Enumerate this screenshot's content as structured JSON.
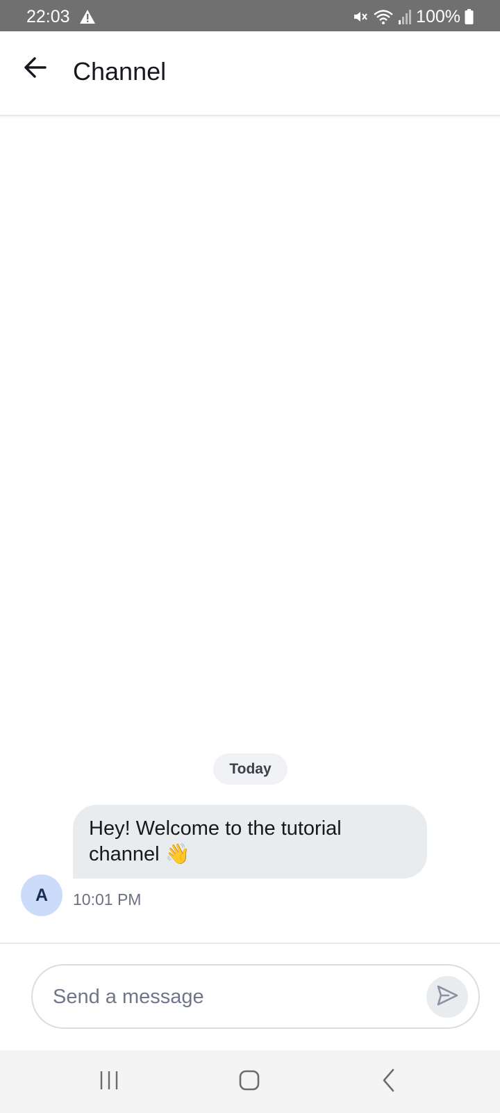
{
  "status_bar": {
    "time": "22:03",
    "battery_text": "100%",
    "icons": [
      "alert-icon",
      "mute-icon",
      "wifi-icon",
      "signal-icon",
      "battery-icon"
    ]
  },
  "header": {
    "title": "Channel",
    "back_icon": "arrow-left-icon"
  },
  "messages": {
    "date_separator": "Today",
    "items": [
      {
        "avatar_initial": "A",
        "text": "Hey! Welcome to the tutorial channel 👋",
        "time": "10:01 PM"
      }
    ]
  },
  "composer": {
    "placeholder": "Send a message",
    "value": "",
    "send_icon": "send-icon"
  },
  "nav_bar": {
    "icons": [
      "recents-icon",
      "home-icon",
      "back-icon"
    ]
  },
  "colors": {
    "status_bar_bg": "#707070",
    "bubble_bg": "#e9ecef",
    "avatar_bg": "#cbdcfb",
    "date_pill_bg": "#f1f2f5",
    "nav_bar_bg": "#f4f4f4"
  }
}
